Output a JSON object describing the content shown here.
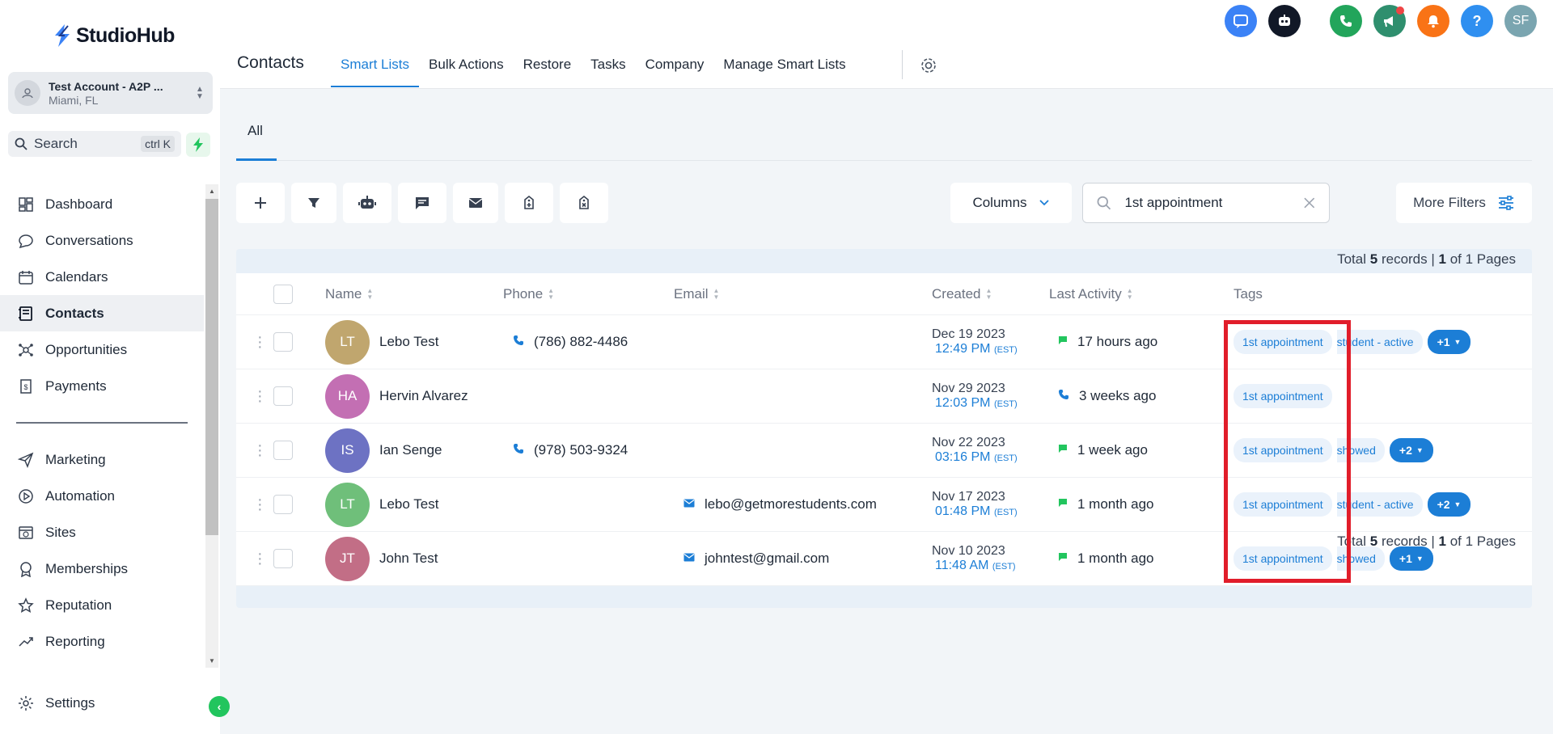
{
  "brand": {
    "name": "StudioHub"
  },
  "account": {
    "name": "Test Account - A2P ...",
    "location": "Miami, FL"
  },
  "search": {
    "label": "Search",
    "shortcut": "ctrl K"
  },
  "nav": {
    "items": [
      {
        "label": "Dashboard",
        "icon": "dashboard-icon"
      },
      {
        "label": "Conversations",
        "icon": "chat-icon"
      },
      {
        "label": "Calendars",
        "icon": "calendar-icon"
      },
      {
        "label": "Contacts",
        "icon": "contacts-icon",
        "active": true
      },
      {
        "label": "Opportunities",
        "icon": "opportunities-icon"
      },
      {
        "label": "Payments",
        "icon": "payments-icon"
      }
    ],
    "items2": [
      {
        "label": "Marketing",
        "icon": "send-icon"
      },
      {
        "label": "Automation",
        "icon": "automation-icon"
      },
      {
        "label": "Sites",
        "icon": "sites-icon"
      },
      {
        "label": "Memberships",
        "icon": "memberships-icon"
      },
      {
        "label": "Reputation",
        "icon": "star-icon"
      },
      {
        "label": "Reporting",
        "icon": "chart-icon"
      }
    ],
    "settings": "Settings"
  },
  "header": {
    "title": "Contacts",
    "tabs": [
      "Smart Lists",
      "Bulk Actions",
      "Restore",
      "Tasks",
      "Company",
      "Manage Smart Lists"
    ],
    "avatar_initials": "SF"
  },
  "smartlist": {
    "tab": "All"
  },
  "controls": {
    "columns": "Columns",
    "search_value": "1st appointment",
    "more_filters": "More Filters"
  },
  "pagination": {
    "prefix": "Total",
    "count": "5",
    "middle": "records |",
    "page": "1",
    "suffix": "of 1 Pages"
  },
  "table": {
    "headers": {
      "name": "Name",
      "phone": "Phone",
      "email": "Email",
      "created": "Created",
      "last_activity": "Last Activity",
      "tags": "Tags"
    },
    "rows": [
      {
        "initials": "LT",
        "color": "#c0a66e",
        "name": "Lebo Test",
        "phone": "(786) 882-4486",
        "email": "",
        "created_date": "Dec 19 2023",
        "created_time": "12:49 PM",
        "tz": "(EST)",
        "activity": "17 hours ago",
        "activity_icon": "message-icon",
        "tags": [
          "1st appointment",
          "student - active"
        ],
        "more": "+1"
      },
      {
        "initials": "HA",
        "color": "#c36fb3",
        "name": "Hervin Alvarez",
        "phone": "",
        "email": "",
        "created_date": "Nov 29 2023",
        "created_time": "12:03 PM",
        "tz": "(EST)",
        "activity": "3 weeks ago",
        "activity_icon": "phone-icon",
        "tags": [
          "1st appointment"
        ],
        "more": ""
      },
      {
        "initials": "IS",
        "color": "#6d72c3",
        "name": "Ian Senge",
        "phone": "(978) 503-9324",
        "email": "",
        "created_date": "Nov 22 2023",
        "created_time": "03:16 PM",
        "tz": "(EST)",
        "activity": "1 week ago",
        "activity_icon": "message-icon",
        "tags": [
          "1st appointment",
          "showed"
        ],
        "more": "+2"
      },
      {
        "initials": "LT",
        "color": "#6fbf7a",
        "name": "Lebo Test",
        "phone": "",
        "email": "lebo@getmorestudents.com",
        "created_date": "Nov 17 2023",
        "created_time": "01:48 PM",
        "tz": "(EST)",
        "activity": "1 month ago",
        "activity_icon": "message-icon",
        "tags": [
          "1st appointment",
          "student - active"
        ],
        "more": "+2"
      },
      {
        "initials": "JT",
        "color": "#c26e86",
        "name": "John Test",
        "phone": "",
        "email": "johntest@gmail.com",
        "created_date": "Nov 10 2023",
        "created_time": "11:48 AM",
        "tz": "(EST)",
        "activity": "1 month ago",
        "activity_icon": "message-icon",
        "tags": [
          "1st appointment",
          "showed"
        ],
        "more": "+1"
      }
    ]
  },
  "colors": {
    "accent": "#1c7ed6",
    "highlight": "#e11d2a",
    "green": "#22c55e"
  }
}
